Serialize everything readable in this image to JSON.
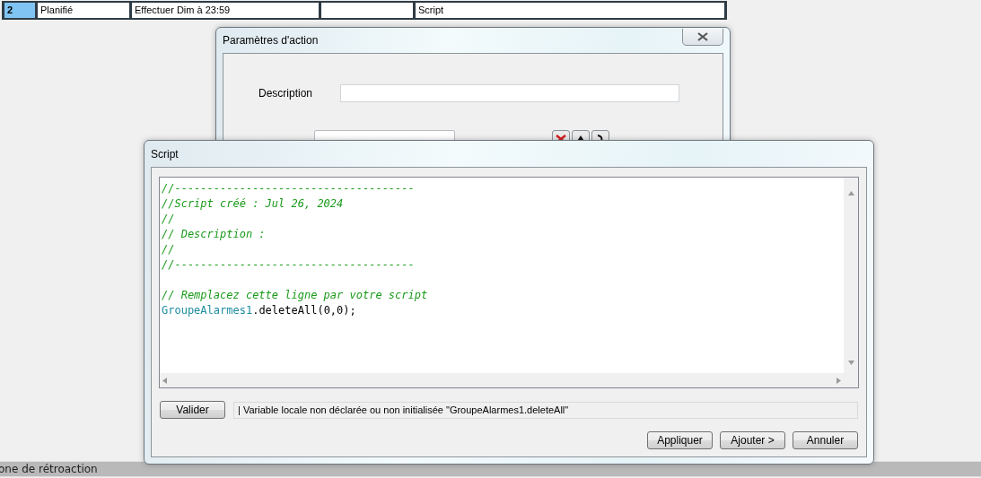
{
  "table_row": {
    "cells": [
      {
        "text": "2",
        "selected": true
      },
      {
        "text": "Planifié",
        "selected": false
      },
      {
        "text": "Effectuer Dim à 23:59",
        "selected": false
      },
      {
        "text": "",
        "selected": false
      },
      {
        "text": "Script",
        "selected": false
      }
    ]
  },
  "action_dialog": {
    "title": "Paramètres d'action",
    "description_label": "Description"
  },
  "script_dialog": {
    "title": "Script",
    "lines": [
      {
        "kind": "comment",
        "text": "//-------------------------------------"
      },
      {
        "kind": "comment",
        "text": "//Script créé : Jul 26, 2024"
      },
      {
        "kind": "comment",
        "text": "//"
      },
      {
        "kind": "comment",
        "text": "// Description :"
      },
      {
        "kind": "comment",
        "text": "//"
      },
      {
        "kind": "comment",
        "text": "//-------------------------------------"
      },
      {
        "kind": "blank"
      },
      {
        "kind": "comment",
        "text": "// Remplacez cette ligne par votre script"
      },
      {
        "kind": "code",
        "identifier": "GroupeAlarmes1",
        "text": ".deleteAll(0,0);"
      }
    ],
    "validate_button": "Valider",
    "message": "| Variable locale non déclarée ou non initialisée \"GroupeAlarmes1.deleteAll\"",
    "buttons": [
      "Appliquer",
      "Ajouter >",
      "Annuler"
    ]
  },
  "status_bar": {
    "text": "one de rétroaction"
  }
}
